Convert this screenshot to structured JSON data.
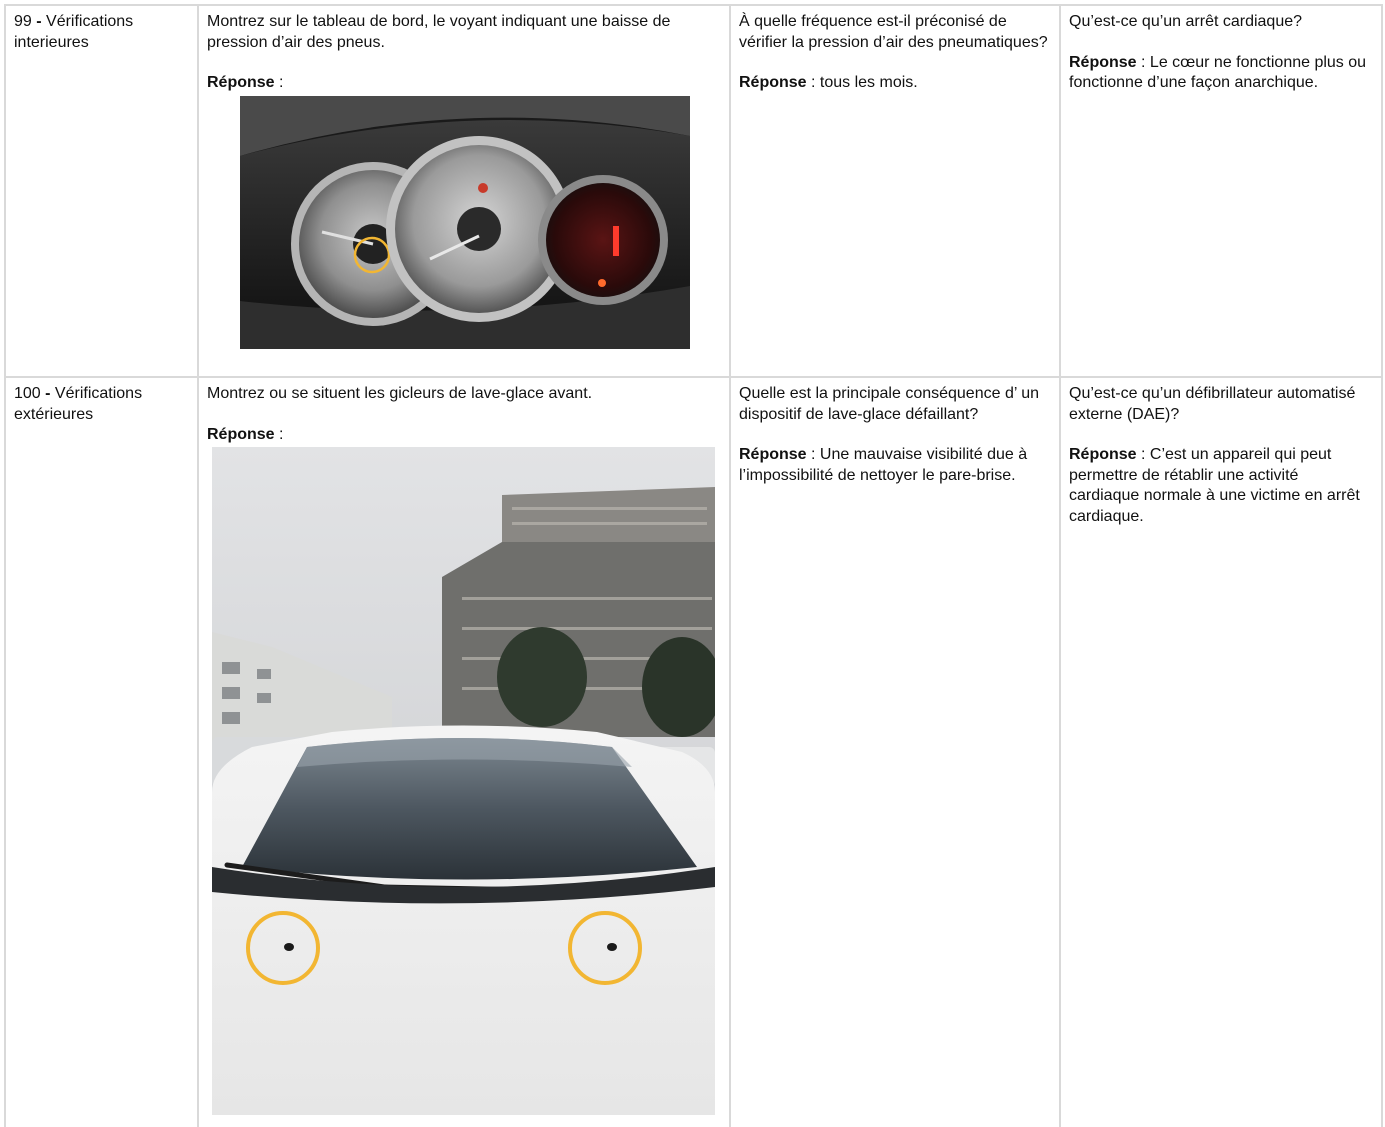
{
  "rows": [
    {
      "category_num": "99",
      "category_sep": " - ",
      "category_label": "Vérifications interieures",
      "question": "Montrez sur le tableau de bord, le voyant indiquant une baisse de pression d’air des pneus.",
      "answer_label": "Réponse",
      "answer_suffix": " :",
      "oral_question": "À quelle fréquence est-il préconisé de vérifier la pression d’air des pneumatiques?",
      "oral_answer_label": "Réponse",
      "oral_answer": " : tous les mois.",
      "first_aid_question": "Qu’est-ce qu’un arrêt cardiaque?",
      "first_aid_answer_label": "Réponse",
      "first_aid_answer": " : Le cœur ne fonctionne plus ou fonctionne d’une façon anarchique."
    },
    {
      "category_num": "100",
      "category_sep": " - ",
      "category_label": "Vérifications extérieures",
      "question": "Montrez ou se situent les gicleurs de lave-glace avant.",
      "answer_label": "Réponse",
      "answer_suffix": " :",
      "oral_question": "Quelle est la principale conséquence d’ un dispositif de lave-glace défaillant?",
      "oral_answer_label": "Réponse",
      "oral_answer": " : Une mauvaise visibilité due à l’impossibilité de nettoyer le pare-brise.",
      "first_aid_question": "Qu’est-ce qu’un défibrillateur automatisé externe (DAE)?",
      "first_aid_answer_label": "Réponse",
      "first_aid_answer": " : C’est un appareil qui peut permettre de rétablir une activité cardiaque normale à une victime en arrêt cardiaque."
    }
  ],
  "images": {
    "dashboard": "dashboard-photo",
    "windshield": "windshield-washer-jets-photo"
  },
  "colors": {
    "highlight_ring": "#f2b632",
    "grid_line": "#d9d9d9"
  }
}
